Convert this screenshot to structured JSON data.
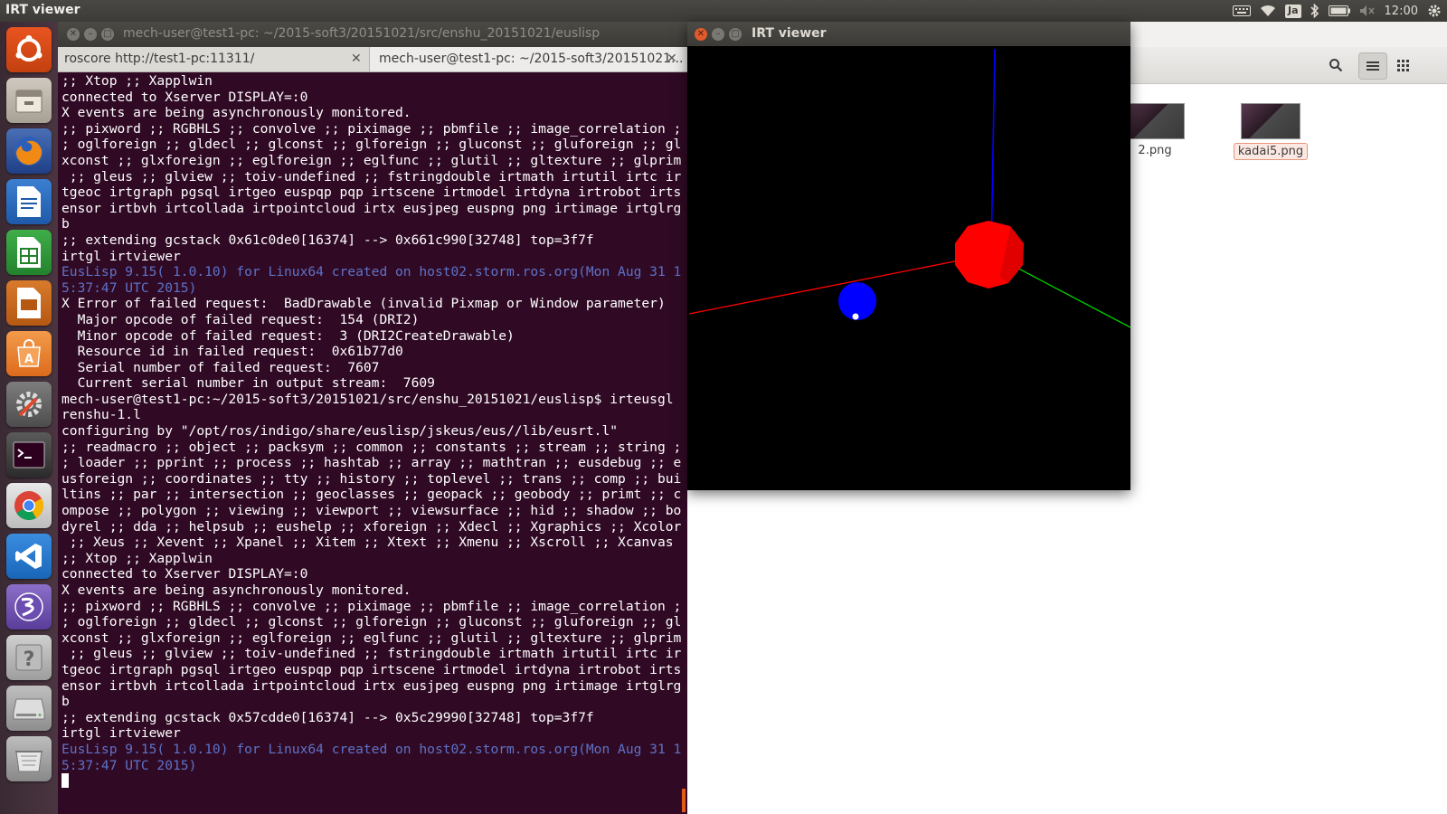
{
  "top_panel": {
    "app_name": "IRT viewer",
    "input_method": "Ja",
    "clock": "12:00",
    "icons": [
      "keyboard-icon",
      "wifi-icon",
      "bluetooth-icon",
      "battery-icon",
      "volume-muted-icon",
      "gear-icon"
    ]
  },
  "launcher": {
    "items": [
      "ubuntu-dash",
      "files",
      "firefox",
      "libreoffice-writer",
      "libreoffice-calc",
      "libreoffice-impress",
      "ubuntu-software-center",
      "system-settings",
      "terminal",
      "chrome",
      "vscode",
      "emacs",
      "help",
      "disk-drive",
      "trash"
    ]
  },
  "terminal": {
    "title": "mech-user@test1-pc: ~/2015-soft3/20151021/src/enshu_20151021/euslisp",
    "tabs": [
      {
        "label": "roscore http://test1-pc:11311/",
        "active": false
      },
      {
        "label": "mech-user@test1-pc: ~/2015-soft3/20151021...",
        "active": true
      }
    ],
    "lines": [
      {
        "text": ";; Xtop ;; Xapplwin",
        "style": "normal"
      },
      {
        "text": "connected to Xserver DISPLAY=:0",
        "style": "normal"
      },
      {
        "text": "X events are being asynchronously monitored.",
        "style": "normal"
      },
      {
        "text": ";; pixword ;; RGBHLS ;; convolve ;; piximage ;; pbmfile ;; image_correlation ;",
        "style": "normal"
      },
      {
        "text": "; oglforeign ;; gldecl ;; glconst ;; glforeign ;; gluconst ;; gluforeign ;; gl",
        "style": "normal"
      },
      {
        "text": "xconst ;; glxforeign ;; eglforeign ;; eglfunc ;; glutil ;; gltexture ;; glprim",
        "style": "normal"
      },
      {
        "text": " ;; gleus ;; glview ;; toiv-undefined ;; fstringdouble irtmath irtutil irtc ir",
        "style": "normal"
      },
      {
        "text": "tgeoc irtgraph pgsql irtgeo euspqp pqp irtscene irtmodel irtdyna irtrobot irts",
        "style": "normal"
      },
      {
        "text": "ensor irtbvh irtcollada irtpointcloud irtx eusjpeg euspng png irtimage irtglrg",
        "style": "normal"
      },
      {
        "text": "b",
        "style": "normal"
      },
      {
        "text": ";; extending gcstack 0x61c0de0[16374] --> 0x661c990[32748] top=3f7f",
        "style": "normal"
      },
      {
        "text": "irtgl irtviewer",
        "style": "normal"
      },
      {
        "text": "EusLisp 9.15( 1.0.10) for Linux64 created on host02.storm.ros.org(Mon Aug 31 1",
        "style": "info"
      },
      {
        "text": "5:37:47 UTC 2015)",
        "style": "info"
      },
      {
        "text": "X Error of failed request:  BadDrawable (invalid Pixmap or Window parameter)",
        "style": "normal"
      },
      {
        "text": "  Major opcode of failed request:  154 (DRI2)",
        "style": "normal"
      },
      {
        "text": "  Minor opcode of failed request:  3 (DRI2CreateDrawable)",
        "style": "normal"
      },
      {
        "text": "  Resource id in failed request:  0x61b77d0",
        "style": "normal"
      },
      {
        "text": "  Serial number of failed request:  7607",
        "style": "normal"
      },
      {
        "text": "  Current serial number in output stream:  7609",
        "style": "normal"
      },
      {
        "text": "mech-user@test1-pc:~/2015-soft3/20151021/src/enshu_20151021/euslisp$ irteusgl",
        "style": "normal"
      },
      {
        "text": "renshu-1.l",
        "style": "normal"
      },
      {
        "text": "configuring by \"/opt/ros/indigo/share/euslisp/jskeus/eus//lib/eusrt.l\"",
        "style": "normal"
      },
      {
        "text": ";; readmacro ;; object ;; packsym ;; common ;; constants ;; stream ;; string ;",
        "style": "normal"
      },
      {
        "text": "; loader ;; pprint ;; process ;; hashtab ;; array ;; mathtran ;; eusdebug ;; e",
        "style": "normal"
      },
      {
        "text": "usforeign ;; coordinates ;; tty ;; history ;; toplevel ;; trans ;; comp ;; bui",
        "style": "normal"
      },
      {
        "text": "ltins ;; par ;; intersection ;; geoclasses ;; geopack ;; geobody ;; primt ;; c",
        "style": "normal"
      },
      {
        "text": "ompose ;; polygon ;; viewing ;; viewport ;; viewsurface ;; hid ;; shadow ;; bo",
        "style": "normal"
      },
      {
        "text": "dyrel ;; dda ;; helpsub ;; eushelp ;; xforeign ;; Xdecl ;; Xgraphics ;; Xcolor",
        "style": "normal"
      },
      {
        "text": " ;; Xeus ;; Xevent ;; Xpanel ;; Xitem ;; Xtext ;; Xmenu ;; Xscroll ;; Xcanvas",
        "style": "normal"
      },
      {
        "text": ";; Xtop ;; Xapplwin",
        "style": "normal"
      },
      {
        "text": "connected to Xserver DISPLAY=:0",
        "style": "normal"
      },
      {
        "text": "X events are being asynchronously monitored.",
        "style": "normal"
      },
      {
        "text": ";; pixword ;; RGBHLS ;; convolve ;; piximage ;; pbmfile ;; image_correlation ;",
        "style": "normal"
      },
      {
        "text": "; oglforeign ;; gldecl ;; glconst ;; glforeign ;; gluconst ;; gluforeign ;; gl",
        "style": "normal"
      },
      {
        "text": "xconst ;; glxforeign ;; eglforeign ;; eglfunc ;; glutil ;; gltexture ;; glprim",
        "style": "normal"
      },
      {
        "text": " ;; gleus ;; glview ;; toiv-undefined ;; fstringdouble irtmath irtutil irtc ir",
        "style": "normal"
      },
      {
        "text": "tgeoc irtgraph pgsql irtgeo euspqp pqp irtscene irtmodel irtdyna irtrobot irts",
        "style": "normal"
      },
      {
        "text": "ensor irtbvh irtcollada irtpointcloud irtx eusjpeg euspng png irtimage irtglrg",
        "style": "normal"
      },
      {
        "text": "b",
        "style": "normal"
      },
      {
        "text": ";; extending gcstack 0x57cdde0[16374] --> 0x5c29990[32748] top=3f7f",
        "style": "normal"
      },
      {
        "text": "irtgl irtviewer",
        "style": "normal"
      },
      {
        "text": "EusLisp 9.15( 1.0.10) for Linux64 created on host02.storm.ros.org(Mon Aug 31 1",
        "style": "info"
      },
      {
        "text": "5:37:47 UTC 2015)",
        "style": "info"
      }
    ]
  },
  "irt_viewer": {
    "title": "IRT viewer",
    "scene": {
      "background": "#000000",
      "axis_colors": {
        "x": "#ff0000",
        "y": "#00cc00",
        "z": "#0000ff"
      },
      "red_sphere_color": "#ff0000",
      "blue_sphere_color": "#0000ff"
    }
  },
  "file_manager": {
    "files": [
      {
        "name": "2.png",
        "selected": false
      },
      {
        "name": "kadai5.png",
        "selected": true
      }
    ]
  },
  "colors": {
    "terminal_bg": "#300a24",
    "terminal_info": "#5e72c8",
    "close_button": "#e05a2b"
  }
}
